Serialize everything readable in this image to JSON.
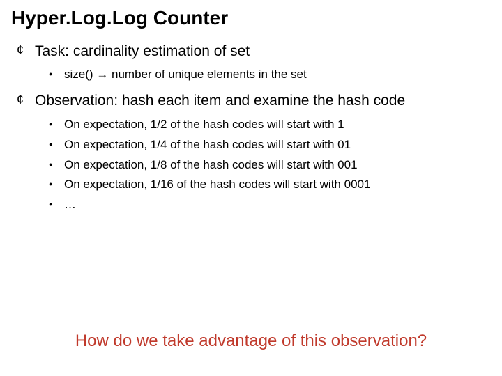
{
  "title": "Hyper.Log.Log Counter",
  "bullets": {
    "b1": "Task: cardinality estimation of set",
    "b1_sub": {
      "s1": "size() → number of unique elements in the set"
    },
    "b2": "Observation: hash each item and examine the hash code",
    "b2_sub": {
      "s1": "On expectation, 1/2 of the hash codes will start with 1",
      "s2": "On expectation, 1/4 of the hash codes will start with 01",
      "s3": "On expectation, 1/8 of the hash codes will start with 001",
      "s4": "On expectation, 1/16 of the hash codes will start with 0001",
      "s5": "…"
    }
  },
  "question": "How do we take advantage of this observation?"
}
